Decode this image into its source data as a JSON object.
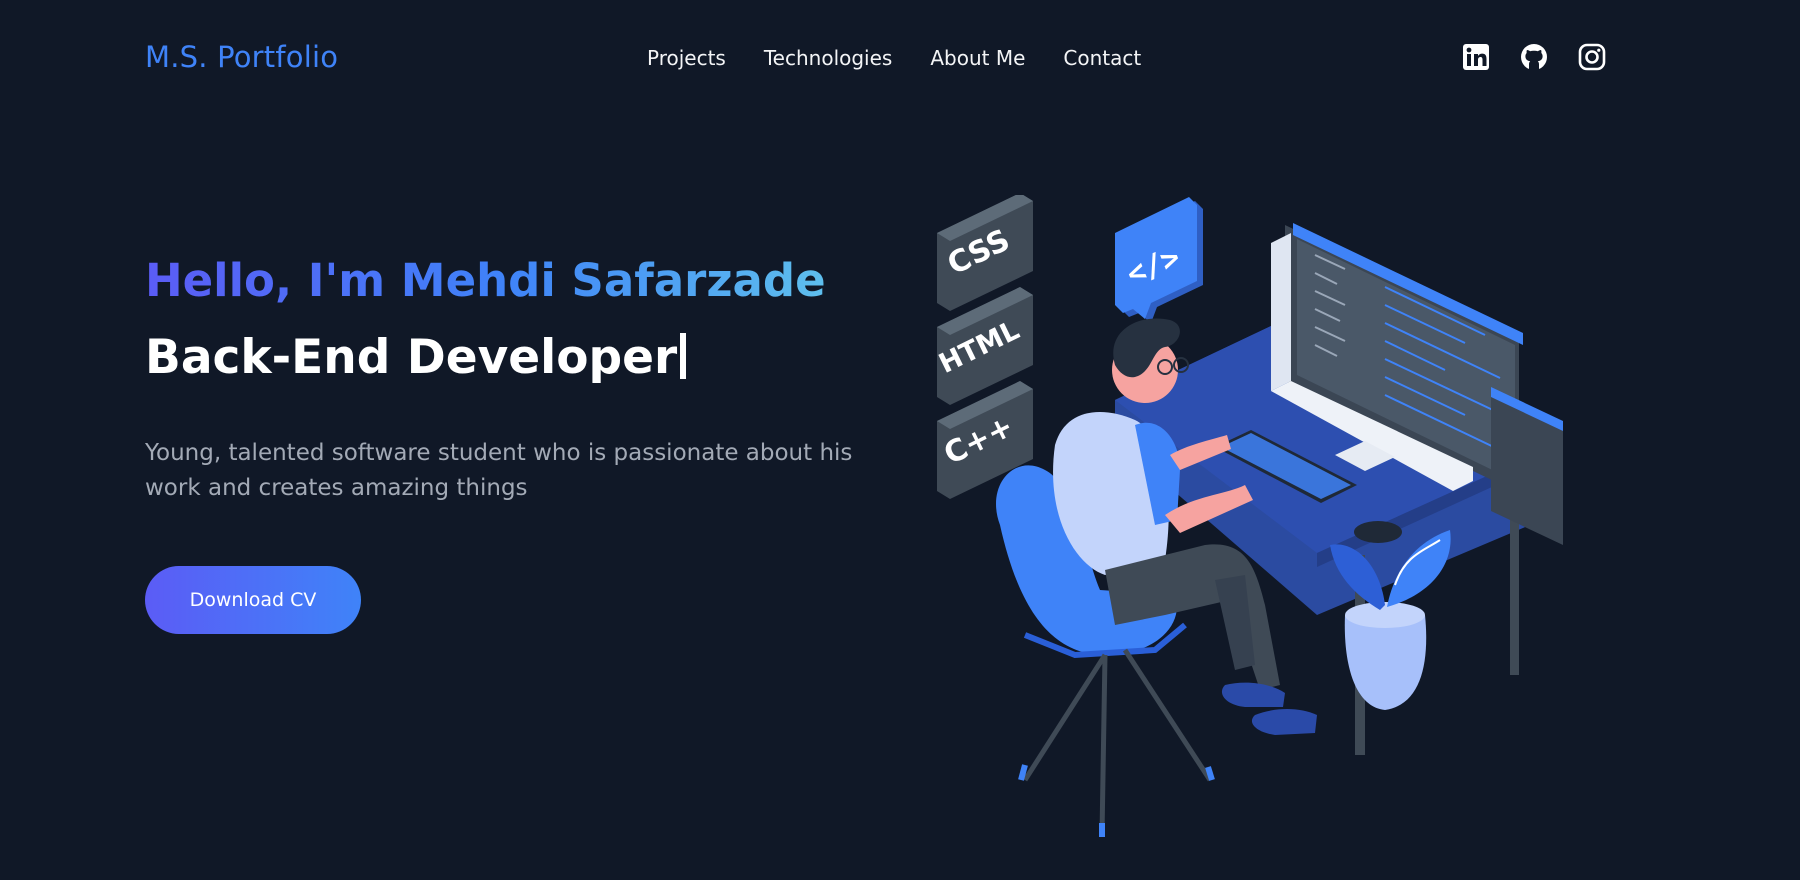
{
  "nav": {
    "logo": "M.S. Portfolio",
    "links": [
      "Projects",
      "Technologies",
      "About Me",
      "Contact"
    ],
    "social_icons": [
      "linkedin-icon",
      "github-icon",
      "instagram-icon"
    ]
  },
  "hero": {
    "greeting": "Hello, I'm Mehdi Safarzade",
    "role": "Back-End Developer",
    "description": "Young, talented software student who is passionate about his work and creates amazing things",
    "cta_label": "Download CV"
  },
  "illustration": {
    "tags": [
      "CSS",
      "HTML",
      "C++"
    ],
    "bubble_code": "</>"
  },
  "colors": {
    "background": "#101827",
    "accent": "#3f83f8",
    "gradient_start": "#5b5cf6",
    "gradient_end": "#62c6ec"
  }
}
